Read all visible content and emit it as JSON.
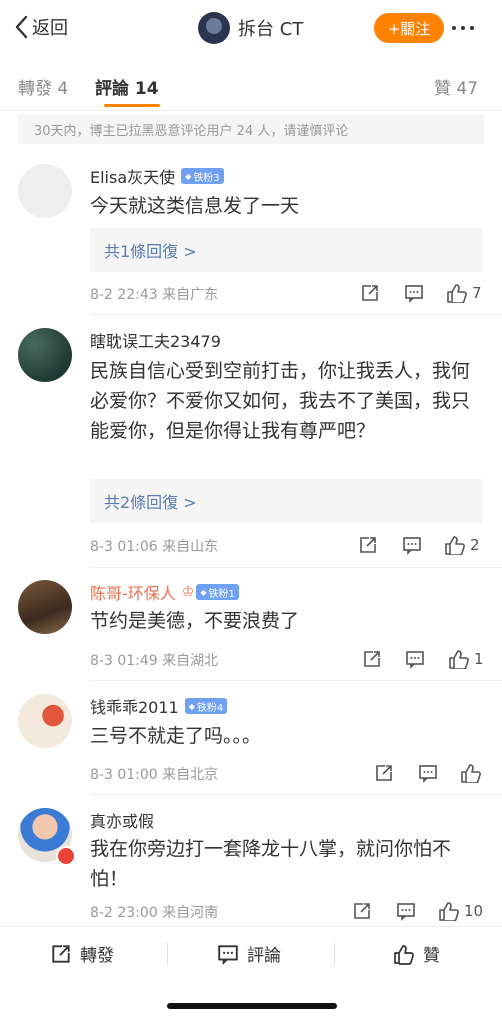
{
  "header": {
    "back_label": "返回",
    "title": "拆台 CT",
    "follow_label": "+關注"
  },
  "tabs": {
    "repost": "轉發 4",
    "comments": "評論 14",
    "likes": "贊 47"
  },
  "notice": "30天内，博主已拉黑恶意评论用户 24 人，请谨慎评论",
  "comments": [
    {
      "name": "Elisa灰天使",
      "badge": "铁粉3",
      "text": "今天就这类信息发了一天",
      "replies": "共1條回復 >",
      "meta": "8-2 22:43  来自广东",
      "likes": "7"
    },
    {
      "name": "瞎耽误工夫23479",
      "badge": "",
      "text": "民族自信心受到空前打击，你让我丢人，我何必爱你？不爱你又如何，我去不了美国，我只能爱你，但是你得让我有尊严吧？",
      "replies": "共2條回復 >",
      "meta": "8-3 01:06  来自山东",
      "likes": "2"
    },
    {
      "name": "陈哥-环保人",
      "badge": "铁粉1",
      "text": "节约是美德，不要浪费了",
      "replies": "",
      "meta": "8-3 01:49  来自湖北",
      "likes": "1"
    },
    {
      "name": "钱乖乖2011",
      "badge": "铁粉4",
      "text": "三号不就走了吗。。。",
      "replies": "",
      "meta": "8-3 01:00  来自北京",
      "likes": ""
    },
    {
      "name": "真亦或假",
      "badge": "",
      "text": "我在你旁边打一套降龙十八掌，就问你怕不怕！",
      "replies": "",
      "meta": "8-2 23:00  来自河南",
      "likes": "10"
    }
  ],
  "bottom": {
    "repost": "轉發",
    "comment": "評論",
    "like": "贊"
  },
  "colors": {
    "accent": "#ff8200",
    "link": "#5a7bb5",
    "badge": "#6fa0f2"
  }
}
